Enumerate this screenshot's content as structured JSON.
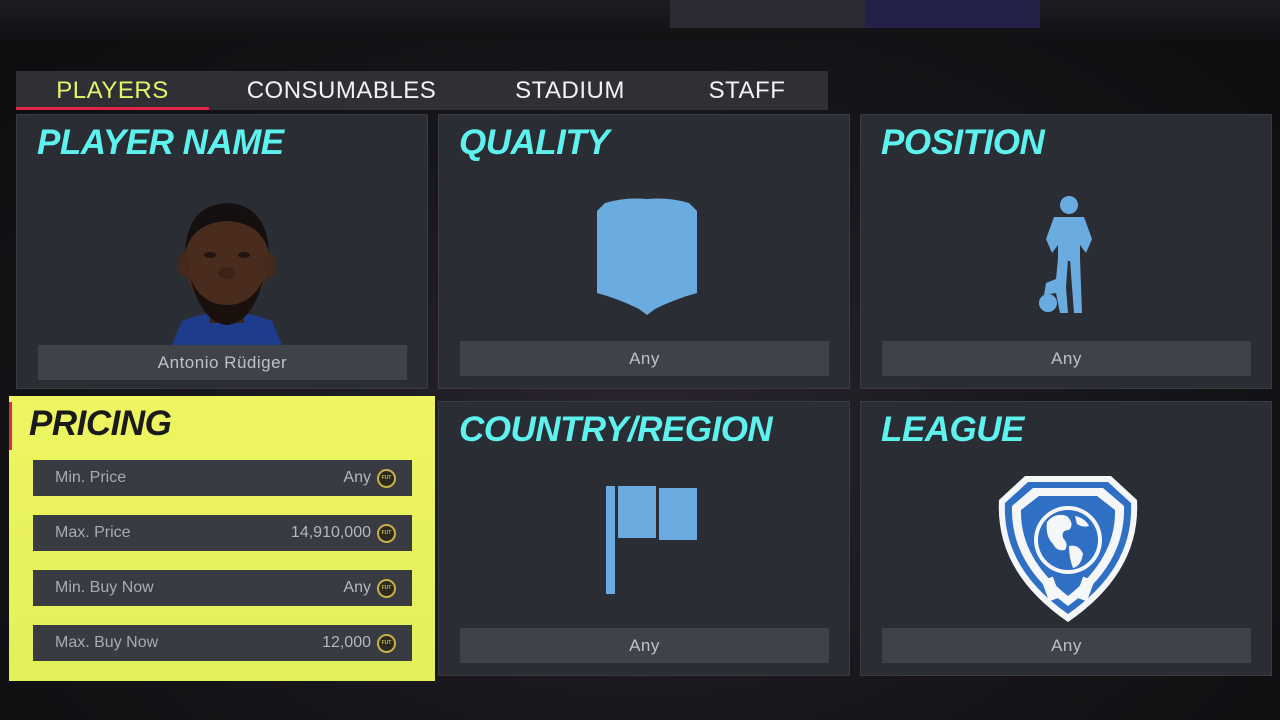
{
  "tabs": [
    {
      "label": "PLAYERS",
      "active": true
    },
    {
      "label": "CONSUMABLES",
      "active": false
    },
    {
      "label": "STADIUM",
      "active": false
    },
    {
      "label": "STAFF",
      "active": false
    }
  ],
  "player_name": {
    "title": "PLAYER NAME",
    "value": "Antonio Rüdiger",
    "icon": "player-portrait"
  },
  "quality": {
    "title": "QUALITY",
    "value": "Any",
    "icon": "card-shield-icon"
  },
  "position": {
    "title": "POSITION",
    "value": "Any",
    "icon": "player-silhouette-icon"
  },
  "pricing": {
    "title": "PRICING",
    "rows": [
      {
        "label": "Min. Price",
        "value": "Any"
      },
      {
        "label": "Max. Price",
        "value": "14,910,000"
      },
      {
        "label": "Min. Buy Now",
        "value": "Any"
      },
      {
        "label": "Max. Buy Now",
        "value": "12,000"
      }
    ],
    "coin_label": "FUT"
  },
  "country": {
    "title": "COUNTRY/REGION",
    "value": "Any",
    "icon": "flag-icon"
  },
  "league": {
    "title": "LEAGUE",
    "value": "Any",
    "icon": "league-globe-crest-icon"
  },
  "colors": {
    "accent": "#5ef2ef",
    "highlight": "#e9f35e",
    "active_tab": "#e7f36a",
    "underline": "#e2264b",
    "icon_blue": "#6aace0"
  }
}
